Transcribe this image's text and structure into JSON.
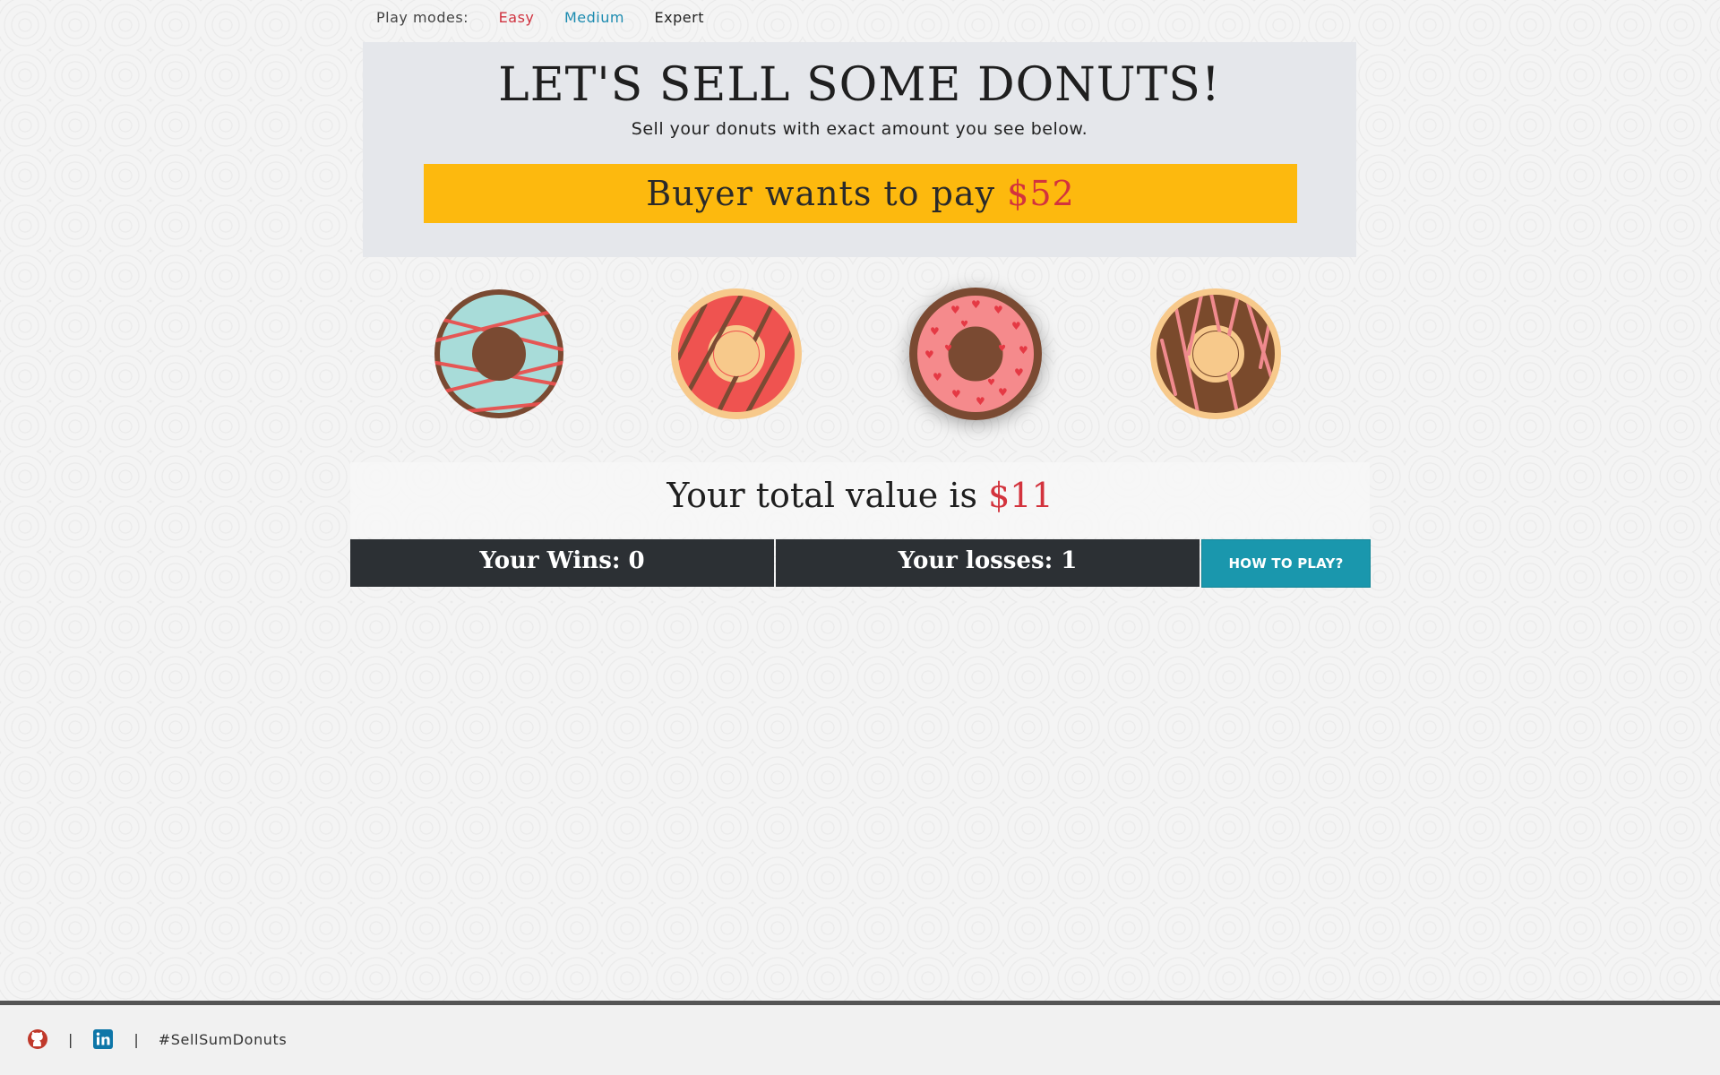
{
  "modes": {
    "label": "Play modes:",
    "easy": "Easy",
    "medium": "Medium",
    "expert": "Expert"
  },
  "header": {
    "title": "LET'S SELL SOME DONUTS!",
    "subtitle": "Sell your donuts with exact amount you see below.",
    "buyer_prefix": "Buyer wants to pay ",
    "buyer_amount": "$52"
  },
  "donuts": [
    {
      "name": "mint-drizzle-donut",
      "icing": "#a8dcd9",
      "stripes": "#e8504f",
      "dough": "#7a4a32"
    },
    {
      "name": "strawberry-chocolate-drizzle-donut",
      "icing": "#ef5350",
      "stripes": "#7b4a33",
      "dough": "#f7c98b"
    },
    {
      "name": "pink-hearts-donut",
      "icing": "#f58a8c",
      "stripes": "#e53944",
      "dough": "#7a4a32",
      "selected": true
    },
    {
      "name": "chocolate-pink-drizzle-donut",
      "icing": "#7a4a2c",
      "stripes": "#f08a8e",
      "dough": "#f7c98b"
    }
  ],
  "total": {
    "prefix": "Your total value is ",
    "amount": "$11"
  },
  "stats": {
    "wins_label": "Your Wins: 0",
    "losses_label": "Your losses: 1",
    "howto_label": "HOW TO PLAY?"
  },
  "footer": {
    "separator": "|",
    "hashtag": "#SellSumDonuts"
  },
  "colors": {
    "accent_red": "#d3333d",
    "buyer_bar": "#fdb90e",
    "howto_button": "#1a97ad",
    "stat_bar": "#2c3034"
  },
  "icons": [
    "github-icon",
    "linkedin-icon"
  ]
}
